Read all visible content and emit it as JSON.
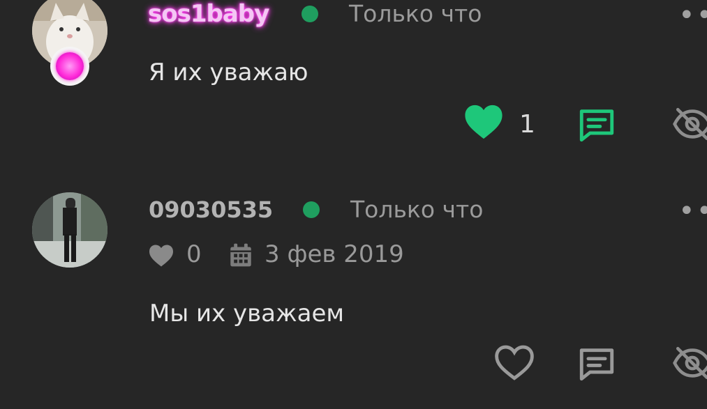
{
  "comments": [
    {
      "username": "sos1baby",
      "time": "Только что",
      "text": "Я их уважаю",
      "likes": "1",
      "liked": true
    },
    {
      "username": "09030535",
      "time": "Только что",
      "likes": "0",
      "date": "3 фев 2019",
      "text": "Мы их уважаем",
      "liked": false
    }
  ],
  "colors": {
    "accent": "#1ec77a",
    "online": "#1f9e5f",
    "background": "#262626"
  },
  "icons": [
    "heart-icon",
    "comment-icon",
    "hide-icon",
    "calendar-icon",
    "more-icon"
  ]
}
